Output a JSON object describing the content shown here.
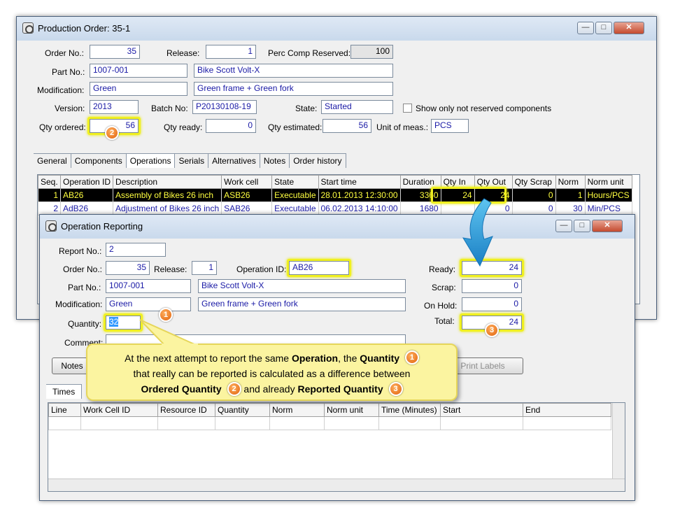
{
  "main_window": {
    "title": "Production Order: 35-1",
    "labels": {
      "order_no": "Order No.:",
      "release": "Release:",
      "perc_comp_reserved": "Perc Comp Reserved:",
      "part_no": "Part No.:",
      "modification": "Modification:",
      "version": "Version:",
      "batch_no": "Batch No:",
      "state": "State:",
      "show_only": "Show only not reserved components",
      "qty_ordered": "Qty ordered:",
      "qty_ready": "Qty ready:",
      "qty_estimated": "Qty estimated:",
      "unit_of_meas": "Unit of meas.:"
    },
    "values": {
      "order_no": "35",
      "release": "1",
      "perc_comp_reserved": "100",
      "part_no": "1007-001",
      "part_desc": "Bike Scott Volt-X",
      "modification": "Green",
      "modification_desc": "Green frame + Green fork",
      "version": "2013",
      "batch_no": "P20130108-19",
      "state": "Started",
      "qty_ordered": "56",
      "qty_ready": "0",
      "qty_estimated": "56",
      "unit_of_meas": "PCS"
    },
    "tabs": [
      "General",
      "Components",
      "Operations",
      "Serials",
      "Alternatives",
      "Notes",
      "Order history"
    ],
    "grid": {
      "columns": [
        "Seq.",
        "Operation ID",
        "Description",
        "Work cell",
        "State",
        "Start time",
        "Duration",
        "Qty In",
        "Qty Out",
        "Qty Scrap",
        "Norm",
        "Norm unit"
      ],
      "rows": [
        [
          "1",
          "AB26",
          "Assembly of Bikes 26 inch",
          "ASB26",
          "Executable",
          "28.01.2013 12:30:00",
          "3360",
          "24",
          "24",
          "0",
          "1",
          "Hours/PCS"
        ],
        [
          "2",
          "AdB26",
          "Adjustment of Bikes 26 inch",
          "SAB26",
          "Executable",
          "06.02.2013 14:10:00",
          "1680",
          "",
          "0",
          "0",
          "30",
          "Min/PCS"
        ]
      ]
    }
  },
  "report_window": {
    "title": "Operation Reporting",
    "labels": {
      "report_no": "Report No.:",
      "order_no": "Order No.:",
      "release": "Release:",
      "operation_id": "Operation ID:",
      "part_no": "Part No.:",
      "modification": "Modification:",
      "quantity": "Quantity:",
      "comment": "Comment:",
      "ready": "Ready:",
      "scrap": "Scrap:",
      "on_hold": "On Hold:",
      "total": "Total:"
    },
    "values": {
      "report_no": "2",
      "order_no": "35",
      "release": "1",
      "operation_id": "AB26",
      "part_no": "1007-001",
      "part_desc": "Bike Scott Volt-X",
      "modification": "Green",
      "modification_desc": "Green frame + Green fork",
      "quantity": "32",
      "ready": "24",
      "scrap": "0",
      "on_hold": "0",
      "total": "24"
    },
    "buttons": {
      "notes": "Notes",
      "print_labels": "Print Labels"
    },
    "tabs": [
      "Times"
    ],
    "grid_columns": [
      "Line",
      "Work Cell ID",
      "Resource ID",
      "Quantity",
      "Norm",
      "Norm unit",
      "Time (Minutes)",
      "Start",
      "End"
    ]
  },
  "callout": {
    "line1_a": "At the next attempt to report the same ",
    "line1_b": "Operation",
    "line1_c": ", the ",
    "line1_d": "Quantity",
    "line2": "that really can be reported is calculated as a difference between",
    "line3_a": "Ordered Quantity",
    "line3_b": " and already ",
    "line3_c": "Reported Quantity"
  },
  "badges": {
    "one": "1",
    "two": "2",
    "three": "3"
  },
  "window_buttons": {
    "minimize": "—",
    "maximize": "□",
    "close": "✕"
  },
  "colors": {
    "highlight": "#f0f020",
    "badge": "#e0600a",
    "arrow": "#2a9bd8",
    "selected_row_text": "#ffff40"
  }
}
